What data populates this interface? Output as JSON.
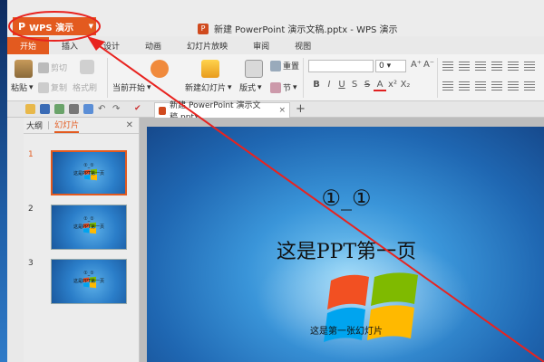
{
  "app": {
    "menu_label": "WPS 演示",
    "menu_logo": "P",
    "window_title": "新建 PowerPoint 演示文稿.pptx - WPS 演示"
  },
  "tabs": [
    "开始",
    "插入",
    "设计",
    "动画",
    "幻灯片放映",
    "审阅",
    "视图"
  ],
  "ribbon": {
    "paste": "粘贴",
    "cut": "剪切",
    "copy": "复制",
    "format_painter": "格式刷",
    "from_current": "当前开始",
    "new_slide": "新建幻灯片",
    "layout": "版式",
    "section": "节",
    "reset": "重置",
    "font_size": "0"
  },
  "document_tab": "新建 PowerPoint 演示文稿.pptx",
  "left_panel": {
    "outline": "大纲",
    "slides": "幻灯片",
    "thumbnails": [
      {
        "num": "1",
        "t1": "①_①",
        "t2": "这是PPT第一页"
      },
      {
        "num": "2",
        "t1": "①_①",
        "t2": "这是PPT第一页"
      },
      {
        "num": "3",
        "t1": "①_①",
        "t2": "这是PPT第一页"
      }
    ]
  },
  "slide": {
    "title": "①_①",
    "subtitle": "这是PPT第一页",
    "note": "这是第一张幻灯片"
  },
  "colors": {
    "accent": "#e35a1f",
    "annotation": "#e8231f"
  }
}
